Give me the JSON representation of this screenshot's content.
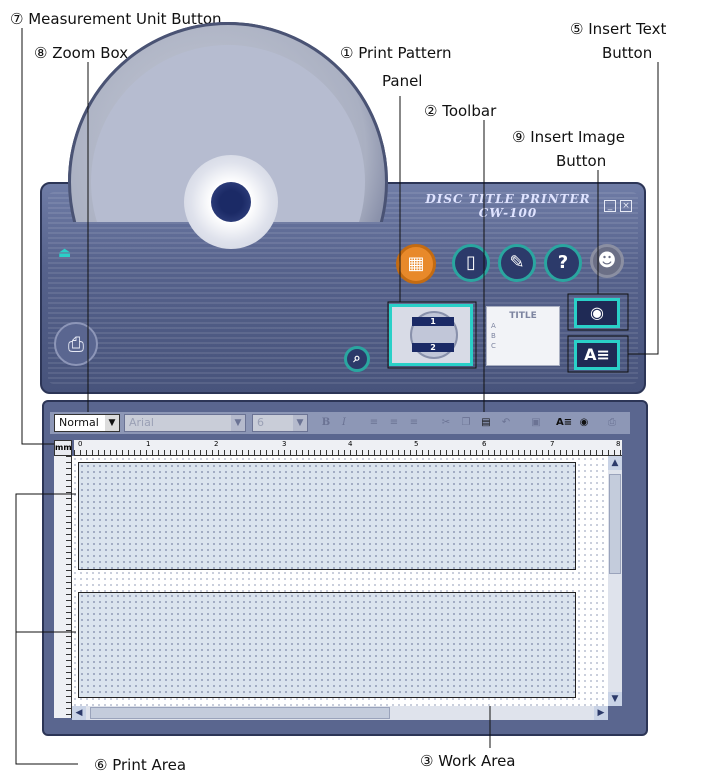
{
  "callouts": {
    "measurement_unit_button": "⑦ Measurement Unit Button",
    "zoom_box": "⑧ Zoom Box",
    "print_pattern_panel_line1": "① Print Pattern",
    "print_pattern_panel_line2": "Panel",
    "toolbar": "② Toolbar",
    "insert_image_button_line1": "⑨ Insert Image",
    "insert_image_button_line2": "Button",
    "insert_text_button_line1": "⑤ Insert Text",
    "insert_text_button_line2": "Button",
    "print_area": "⑥ Print Area",
    "work_area": "③ Work Area"
  },
  "app": {
    "brand_line1": "DISC TITLE PRINTER",
    "brand_line2": "CW-100"
  },
  "print_pattern": {
    "label_1": "1",
    "label_2": "2"
  },
  "title_card": {
    "title": "TITLE",
    "rows": [
      "A",
      "B",
      "C"
    ]
  },
  "toolbar": {
    "zoom_value": "Normal",
    "font_value": "Arial",
    "size_value": "6",
    "bold": "B",
    "italic": "I"
  },
  "unit_button": "mm",
  "ruler": {
    "ticks": [
      "0",
      "1",
      "2",
      "3",
      "4",
      "5",
      "6",
      "7",
      "8"
    ]
  }
}
